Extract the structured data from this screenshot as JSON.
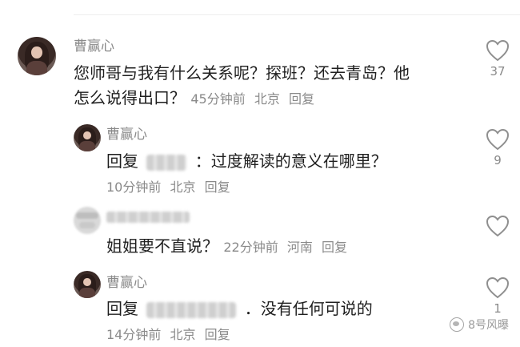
{
  "comments": [
    {
      "username": "曹赢心",
      "text_line1": "您师哥与我有什么关系呢？探班？还去青岛？他",
      "text_line2": "怎么说得出口？",
      "time": "45分钟前",
      "location": "北京",
      "reply_label": "回复",
      "likes": "37"
    },
    {
      "username": "曹赢心",
      "reply_prefix": "回复",
      "reply_text": "：过度解读的意义在哪里？",
      "time": "10分钟前",
      "location": "北京",
      "reply_label": "回复",
      "likes": "9"
    },
    {
      "text": "姐姐要不直说？",
      "time": "22分钟前",
      "location": "河南",
      "reply_label": "回复",
      "likes": ""
    },
    {
      "username": "曹赢心",
      "reply_prefix": "回复",
      "reply_text": "．没有任何可说的",
      "time": "14分钟前",
      "location": "北京",
      "reply_label": "回复",
      "likes": "1"
    }
  ],
  "watermark": "8号风曝"
}
